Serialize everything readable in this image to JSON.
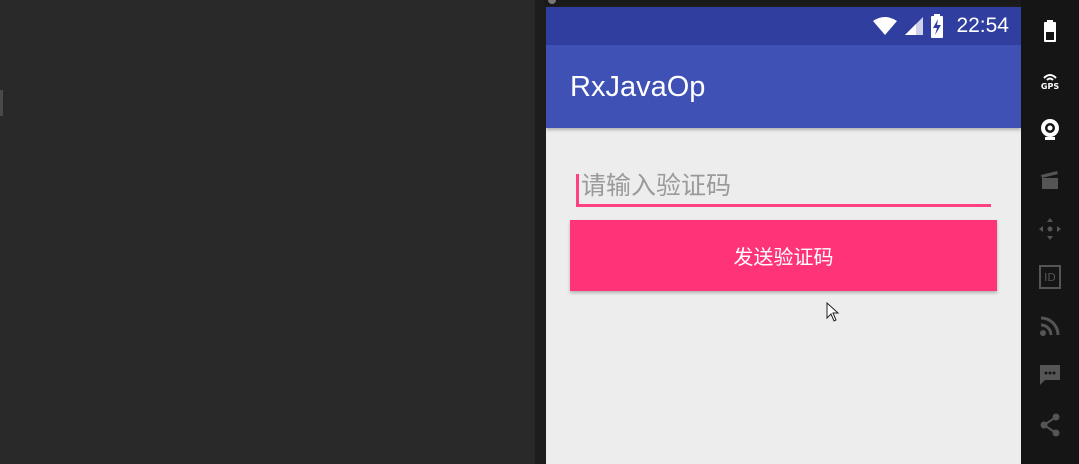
{
  "status_bar": {
    "time": "22:54",
    "wifi_icon": "wifi-icon",
    "signal_icon": "signal-icon",
    "battery_icon": "battery-charging-icon"
  },
  "app_bar": {
    "title": "RxJavaOp"
  },
  "form": {
    "code_input": {
      "placeholder": "请输入验证码",
      "value": ""
    },
    "send_button": {
      "label": "发送验证码"
    }
  },
  "emulator_sidebar": {
    "items": [
      {
        "icon": "battery-icon"
      },
      {
        "icon": "gps-icon",
        "label": "GPS"
      },
      {
        "icon": "camera-icon"
      },
      {
        "icon": "clapperboard-icon"
      },
      {
        "icon": "dpad-icon"
      },
      {
        "icon": "id-icon",
        "label": "ID"
      },
      {
        "icon": "rss-icon"
      },
      {
        "icon": "sms-icon"
      },
      {
        "icon": "share-icon"
      }
    ]
  },
  "colors": {
    "primary": "#3f51b5",
    "primary_dark": "#303f9f",
    "accent": "#ff4081",
    "button": "#ff3377",
    "background": "#ededed"
  }
}
